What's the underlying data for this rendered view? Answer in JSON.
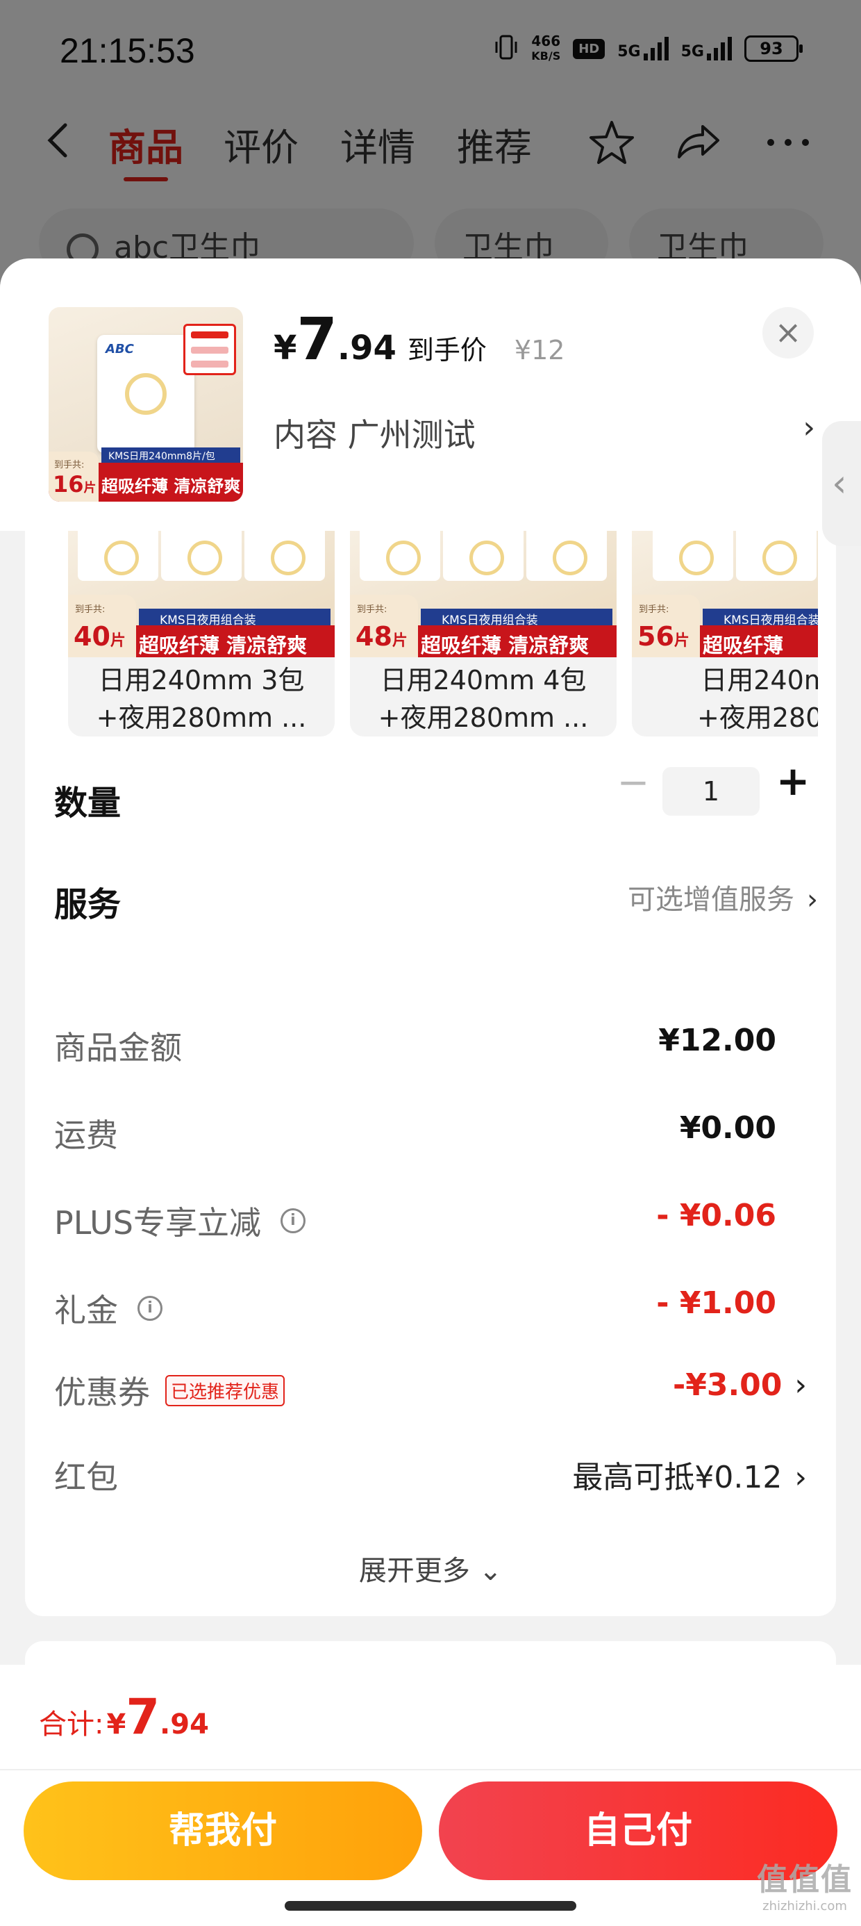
{
  "status_bar": {
    "time": "21:15:53",
    "net_speed_top": "466",
    "net_speed_unit": "KB/S",
    "hd_label": "HD",
    "sim1": "5G",
    "sim2": "5G",
    "battery": "93"
  },
  "nav": {
    "tabs": [
      {
        "label": "商品",
        "active": true
      },
      {
        "label": "评价",
        "active": false
      },
      {
        "label": "详情",
        "active": false
      },
      {
        "label": "推荐",
        "active": false
      }
    ]
  },
  "search_suggestions": [
    "abc卫生巾",
    "卫生巾",
    "卫生巾abc"
  ],
  "sheet": {
    "product_thumb": {
      "brand": "ABC",
      "blue_band": "KMS日用240mm8片/包",
      "count_label": "到手共:",
      "count": "16",
      "count_unit": "片",
      "slogan": "超吸纤薄 清凉舒爽"
    },
    "price": {
      "symbol": "¥",
      "integer": "7",
      "decimal": ".94",
      "tag": "到手价",
      "original": "¥12"
    },
    "selection": {
      "text": "内容  广州测试",
      "chevron": "›"
    },
    "close_icon": "×"
  },
  "variants": [
    {
      "count_label": "到手共:",
      "count": "40",
      "unit": "片",
      "blue_band": "KMS日夜用组合装",
      "slogan": "超吸纤薄 清凉舒爽",
      "line1": "日用240mm 3包",
      "line2": "+夜用280mm ..."
    },
    {
      "count_label": "到手共:",
      "count": "48",
      "unit": "片",
      "blue_band": "KMS日夜用组合装",
      "slogan": "超吸纤薄 清凉舒爽",
      "line1": "日用240mm 4包",
      "line2": "+夜用280mm ..."
    },
    {
      "count_label": "到手共:",
      "count": "56",
      "unit": "片",
      "blue_band": "KMS日夜用组合装",
      "slogan": "超吸纤薄",
      "line1": "日用240m",
      "line2": "+夜用280r"
    }
  ],
  "side_tab_icon": "‹",
  "quantity": {
    "label": "数量",
    "minus": "−",
    "value": "1",
    "plus": "+"
  },
  "service": {
    "label": "服务",
    "value": "可选增值服务",
    "chevron": "›"
  },
  "costs": {
    "rows": [
      {
        "label": "商品金额",
        "value": "¥12.00"
      },
      {
        "label": "运费",
        "value": "¥0.00"
      },
      {
        "label": "PLUS专享立减",
        "value": "- ¥0.06"
      },
      {
        "label": "礼金",
        "value": "- ¥1.00"
      },
      {
        "label": "优惠券",
        "tag": "已选推荐优惠",
        "value": "-¥3.00"
      },
      {
        "label": "红包",
        "value": "最高可抵¥0.12"
      }
    ],
    "expand": "展开更多 ⌄",
    "info_icon": "i",
    "chevron": "›"
  },
  "bottom": {
    "total_label": "合计:",
    "total_symbol": "¥",
    "total_integer": "7",
    "total_decimal": ".94",
    "help_pay": "帮我付",
    "self_pay": "自己付"
  },
  "watermark": {
    "big": "值值值",
    "small": "zhizhizhi.com"
  },
  "colors": {
    "accent_red": "#e2231a",
    "help_button": "#ffb313",
    "self_button": "#f7363a"
  }
}
